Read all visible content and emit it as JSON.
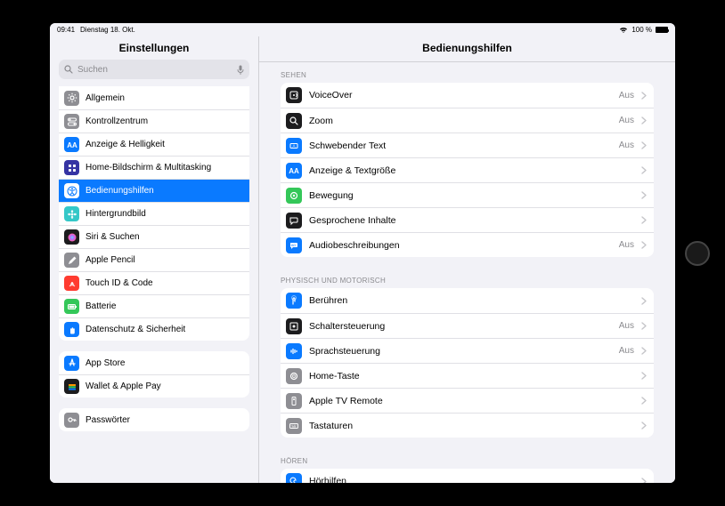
{
  "statusbar": {
    "time": "09:41",
    "date": "Dienstag 18. Okt.",
    "battery_text": "100 %"
  },
  "sidebar": {
    "title": "Einstellungen",
    "search_placeholder": "Suchen",
    "groups": [
      {
        "items": [
          {
            "id": "allgemein",
            "label": "Allgemein",
            "icon_bg": "#8e8e93",
            "icon": "gear"
          },
          {
            "id": "kontrollzentrum",
            "label": "Kontrollzentrum",
            "icon_bg": "#8e8e93",
            "icon": "switches"
          },
          {
            "id": "anzeige",
            "label": "Anzeige & Helligkeit",
            "icon_bg": "#0a7aff",
            "icon": "aa"
          },
          {
            "id": "homescreen",
            "label": "Home-Bildschirm & Multitasking",
            "icon_bg": "#3634a3",
            "icon": "grid"
          },
          {
            "id": "bedienungshilfen",
            "label": "Bedienungshilfen",
            "icon_bg": "#0a7aff",
            "icon": "accessibility",
            "selected": true
          },
          {
            "id": "hintergrundbild",
            "label": "Hintergrundbild",
            "icon_bg": "#34c8c8",
            "icon": "flower"
          },
          {
            "id": "siri",
            "label": "Siri & Suchen",
            "icon_bg": "#1c1c1e",
            "icon": "siri"
          },
          {
            "id": "pencil",
            "label": "Apple Pencil",
            "icon_bg": "#8e8e93",
            "icon": "pencil"
          },
          {
            "id": "touchid",
            "label": "Touch ID & Code",
            "icon_bg": "#ff3b30",
            "icon": "fingerprint"
          },
          {
            "id": "batterie",
            "label": "Batterie",
            "icon_bg": "#34c759",
            "icon": "battery"
          },
          {
            "id": "datenschutz",
            "label": "Datenschutz & Sicherheit",
            "icon_bg": "#0a7aff",
            "icon": "hand"
          }
        ]
      },
      {
        "items": [
          {
            "id": "appstore",
            "label": "App Store",
            "icon_bg": "#0a7aff",
            "icon": "appstore"
          },
          {
            "id": "wallet",
            "label": "Wallet & Apple Pay",
            "icon_bg": "#1c1c1e",
            "icon": "wallet"
          }
        ]
      },
      {
        "items": [
          {
            "id": "passwoerter",
            "label": "Passwörter",
            "icon_bg": "#8e8e93",
            "icon": "key"
          }
        ]
      }
    ]
  },
  "detail": {
    "title": "Bedienungshilfen",
    "value_off": "Aus",
    "sections": [
      {
        "header": "SEHEN",
        "items": [
          {
            "id": "voiceover",
            "label": "VoiceOver",
            "value": "Aus",
            "icon_bg": "#1c1c1e",
            "icon": "voiceover"
          },
          {
            "id": "zoom",
            "label": "Zoom",
            "value": "Aus",
            "icon_bg": "#1c1c1e",
            "icon": "zoom"
          },
          {
            "id": "schwebender-text",
            "label": "Schwebender Text",
            "value": "Aus",
            "icon_bg": "#0a7aff",
            "icon": "hovertext"
          },
          {
            "id": "anzeige-text",
            "label": "Anzeige & Textgröße",
            "value": "",
            "icon_bg": "#0a7aff",
            "icon": "aa"
          },
          {
            "id": "bewegung",
            "label": "Bewegung",
            "value": "",
            "icon_bg": "#34c759",
            "icon": "motion"
          },
          {
            "id": "gesprochene",
            "label": "Gesprochene Inhalte",
            "value": "",
            "icon_bg": "#1c1c1e",
            "icon": "speech"
          },
          {
            "id": "audiodesc",
            "label": "Audiobeschreibungen",
            "value": "Aus",
            "icon_bg": "#0a7aff",
            "icon": "audiodesc"
          }
        ]
      },
      {
        "header": "PHYSISCH UND MOTORISCH",
        "items": [
          {
            "id": "beruehren",
            "label": "Berühren",
            "value": "",
            "icon_bg": "#0a7aff",
            "icon": "touch"
          },
          {
            "id": "schaltersteuerung",
            "label": "Schaltersteuerung",
            "value": "Aus",
            "icon_bg": "#1c1c1e",
            "icon": "switchcontrol"
          },
          {
            "id": "sprachsteuerung",
            "label": "Sprachsteuerung",
            "value": "Aus",
            "icon_bg": "#0a7aff",
            "icon": "voicecontrol"
          },
          {
            "id": "hometaste",
            "label": "Home-Taste",
            "value": "",
            "icon_bg": "#8e8e93",
            "icon": "homebutton"
          },
          {
            "id": "appletv",
            "label": "Apple TV Remote",
            "value": "",
            "icon_bg": "#8e8e93",
            "icon": "remote"
          },
          {
            "id": "tastaturen",
            "label": "Tastaturen",
            "value": "",
            "icon_bg": "#8e8e93",
            "icon": "keyboard"
          }
        ]
      },
      {
        "header": "HÖREN",
        "items": [
          {
            "id": "hoerhilfen",
            "label": "Hörhilfen",
            "value": "",
            "icon_bg": "#0a7aff",
            "icon": "ear"
          }
        ]
      }
    ]
  }
}
